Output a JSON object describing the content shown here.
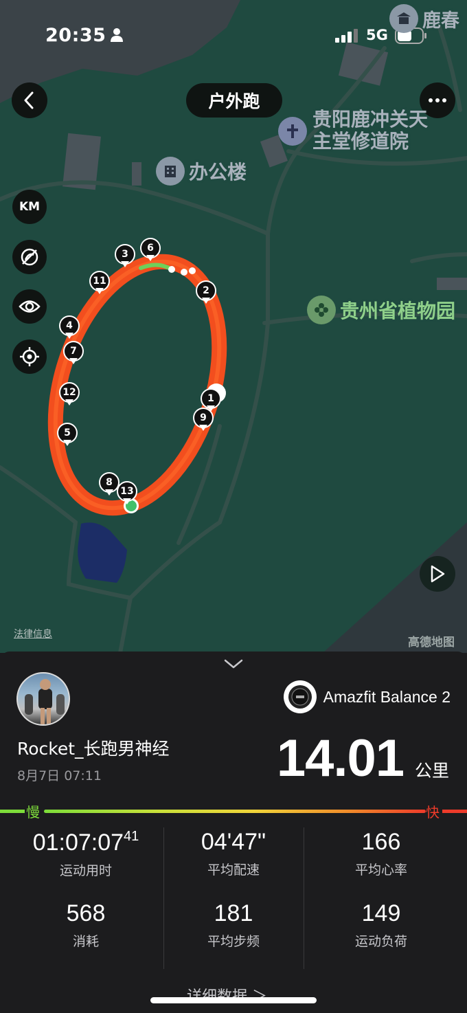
{
  "status_bar": {
    "time": "20:35",
    "network": "5G"
  },
  "header": {
    "title": "户外跑"
  },
  "map_controls": {
    "unit_label": "KM"
  },
  "map_labels": {
    "poi_top_right": "鹿春",
    "poi_church_line1": "贵阳鹿冲关天",
    "poi_church_line2": "主堂修道院",
    "poi_office": "办公楼",
    "poi_botanical": "贵州省植物园",
    "legal": "法律信息",
    "provider": "高德地图"
  },
  "route_markers": [
    "1",
    "2",
    "3",
    "4",
    "5",
    "6",
    "7",
    "8",
    "9",
    "11",
    "12",
    "13"
  ],
  "summary": {
    "device_name": "Amazfit Balance 2",
    "username": "Rocket_长跑男神经",
    "datetime": "8月7日 07:11",
    "distance": "14.01",
    "distance_unit": "公里",
    "pace_slow": "慢",
    "pace_fast": "快"
  },
  "stats": [
    {
      "value": "01:07:07",
      "value_sup": "41",
      "label": "运动用时"
    },
    {
      "value": "04'47\"",
      "label": "平均配速"
    },
    {
      "value": "166",
      "label": "平均心率"
    },
    {
      "value": "568",
      "label": "消耗"
    },
    {
      "value": "181",
      "label": "平均步频"
    },
    {
      "value": "149",
      "label": "运动负荷"
    }
  ],
  "more_link": "详细数据 ＞",
  "colors": {
    "route": "#f24e1e",
    "map_bg": "#1f4a40",
    "panel_bg": "#1c1c1e"
  }
}
